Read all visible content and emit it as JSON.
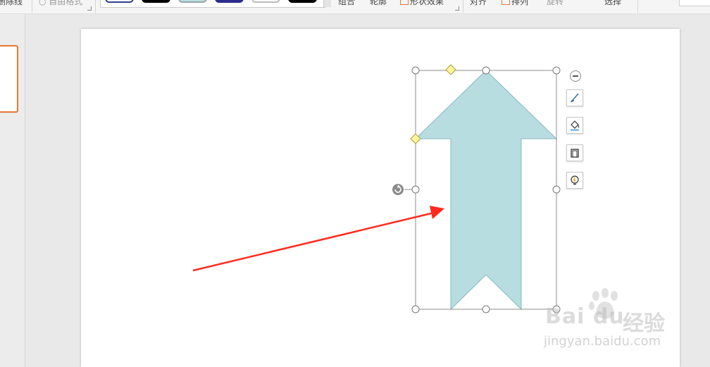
{
  "ribbon": {
    "items": [
      {
        "name": "ribbon-left-clipped",
        "label": "删除线"
      },
      {
        "name": "ribbon-gray-clipped",
        "label": "○ 自由格式"
      },
      {
        "name": "ribbon-item-a",
        "label": "组合"
      },
      {
        "name": "ribbon-item-b",
        "label": "轮廓"
      },
      {
        "name": "ribbon-item-c",
        "label": "形状效果"
      },
      {
        "name": "ribbon-item-d",
        "label": "对齐"
      },
      {
        "name": "ribbon-item-e",
        "label": "排列"
      },
      {
        "name": "ribbon-item-f",
        "label": "选择"
      },
      {
        "name": "ribbon-item-g",
        "label": "旋转"
      }
    ],
    "style_chips": [
      {
        "fill": "#ffffff",
        "border": "#2f3f8f"
      },
      {
        "fill": "#000000",
        "border": "#000000"
      },
      {
        "fill": "#b7dde1",
        "border": "#9aa6aa"
      },
      {
        "fill": "#2c2c8c",
        "border": "#2c2c8c"
      },
      {
        "fill": "#ffffff",
        "border": "#bbbbbb"
      },
      {
        "fill": "#000000",
        "border": "#000000"
      }
    ]
  },
  "shape": {
    "type": "up-arrow",
    "fill": "#b7dde1",
    "stroke": "#8ab8bd"
  },
  "annotation": {
    "color": "#ff2a1f"
  },
  "shape_tools": [
    {
      "name": "shape-style-tool",
      "icon": "brush-icon"
    },
    {
      "name": "shape-fill-tool",
      "icon": "paint-bucket-icon"
    },
    {
      "name": "shape-outline-tool",
      "icon": "outline-icon"
    },
    {
      "name": "shape-effect-tool",
      "icon": "lightbulb-icon"
    }
  ],
  "watermark": {
    "brand": "Bai du",
    "cn": "经验",
    "url": "jingyan.baidu.com"
  }
}
